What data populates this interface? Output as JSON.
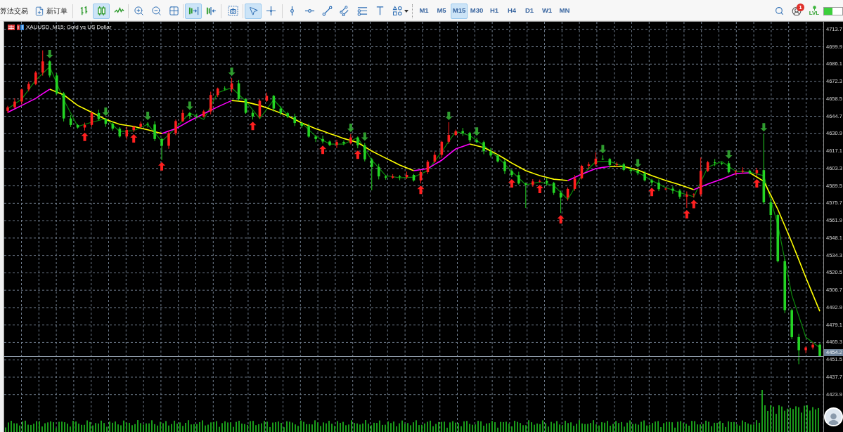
{
  "toolbar": {
    "algo_trading": "算法交易",
    "new_order": "新订单",
    "chart_types": [
      {
        "selected": false
      },
      {
        "selected": true
      },
      {
        "selected": false
      }
    ],
    "view_toggles": [
      {
        "selected": true
      },
      {
        "selected": false
      }
    ],
    "cursor_tools": [
      {
        "selected": true
      },
      {
        "selected": false
      }
    ],
    "timeframes": [
      {
        "label": "M1",
        "selected": false
      },
      {
        "label": "M5",
        "selected": false
      },
      {
        "label": "M15",
        "selected": true
      },
      {
        "label": "M30",
        "selected": false
      },
      {
        "label": "H1",
        "selected": false
      },
      {
        "label": "H4",
        "selected": false
      },
      {
        "label": "D1",
        "selected": false
      },
      {
        "label": "W1",
        "selected": false
      },
      {
        "label": "MN",
        "selected": false
      }
    ],
    "notification_badge": "1",
    "lvl_label": "LVL"
  },
  "chart": {
    "title": "XAUUSD, M15: Gold vs US Dollar",
    "current_price": "4454.2",
    "chart_data": {
      "type": "candlestick",
      "grid": true,
      "ylim": [
        4394.2,
        4719.7
      ],
      "yticks": [
        4713.7,
        4699.9,
        4686.1,
        4672.3,
        4658.5,
        4644.7,
        4630.9,
        4617.1,
        4603.3,
        4589.5,
        4575.7,
        4561.9,
        4548.1,
        4534.3,
        4520.5,
        4506.7,
        4492.9,
        4479.1,
        4465.3,
        4451.5,
        4437.7,
        4423.9
      ],
      "ohlc": [
        [
          4649.0,
          4653.0,
          4647.4,
          4651.8
        ],
        [
          4651.8,
          4659.0,
          4650.9,
          4656.4
        ],
        [
          4656.4,
          4666.8,
          4654.0,
          4666.0
        ],
        [
          4666.0,
          4672.1,
          4664.4,
          4670.3
        ],
        [
          4670.3,
          4680.6,
          4669.4,
          4679.4
        ],
        [
          4679.4,
          4697.0,
          4677.0,
          4688.3
        ],
        [
          4688.3,
          4689.1,
          4675.5,
          4677.1
        ],
        [
          4677.1,
          4678.9,
          4661.9,
          4662.8
        ],
        [
          4662.8,
          4664.0,
          4640.6,
          4643.0
        ],
        [
          4643.0,
          4645.6,
          4636.2,
          4637.8
        ],
        [
          4637.8,
          4638.6,
          4634.9,
          4635.8
        ],
        [
          4635.8,
          4639.7,
          4633.4,
          4637.9
        ],
        [
          4637.9,
          4648.5,
          4636.3,
          4647.3
        ],
        [
          4647.3,
          4649.9,
          4641.6,
          4642.5
        ],
        [
          4642.5,
          4643.3,
          4636.3,
          4638.7
        ],
        [
          4638.7,
          4640.5,
          4633.3,
          4634.9
        ],
        [
          4634.9,
          4636.1,
          4627.8,
          4628.7
        ],
        [
          4628.7,
          4636.4,
          4626.3,
          4633.8
        ],
        [
          4633.8,
          4637.1,
          4632.2,
          4636.3
        ],
        [
          4636.3,
          4640.6,
          4635.4,
          4638.8
        ],
        [
          4638.8,
          4640.0,
          4635.8,
          4638.2
        ],
        [
          4638.2,
          4640.8,
          4625.1,
          4626.7
        ],
        [
          4626.7,
          4627.5,
          4610.0,
          4621.3
        ],
        [
          4621.3,
          4633.1,
          4618.9,
          4631.3
        ],
        [
          4631.3,
          4642.1,
          4629.7,
          4640.9
        ],
        [
          4640.9,
          4649.9,
          4640.0,
          4647.3
        ],
        [
          4647.3,
          4648.1,
          4642.6,
          4645.0
        ],
        [
          4645.0,
          4646.8,
          4643.0,
          4644.6
        ],
        [
          4644.6,
          4649.8,
          4643.7,
          4648.6
        ],
        [
          4648.6,
          4664.2,
          4646.2,
          4661.6
        ],
        [
          4661.6,
          4667.5,
          4660.0,
          4666.7
        ],
        [
          4666.7,
          4668.5,
          4665.2,
          4666.1
        ],
        [
          4666.1,
          4675.0,
          4663.7,
          4670.9
        ],
        [
          4670.9,
          4673.5,
          4656.7,
          4658.3
        ],
        [
          4658.3,
          4659.1,
          4646.6,
          4647.5
        ],
        [
          4647.5,
          4649.3,
          4642.1,
          4644.5
        ],
        [
          4644.5,
          4658.2,
          4642.9,
          4657.0
        ],
        [
          4657.0,
          4663.5,
          4656.1,
          4660.9
        ],
        [
          4660.9,
          4661.7,
          4648.4,
          4650.8
        ],
        [
          4650.8,
          4652.6,
          4645.5,
          4647.1
        ],
        [
          4647.1,
          4648.3,
          4643.3,
          4644.2
        ],
        [
          4644.2,
          4646.8,
          4637.0,
          4639.4
        ],
        [
          4639.4,
          4640.2,
          4635.5,
          4637.1
        ],
        [
          4637.1,
          4638.9,
          4627.7,
          4628.6
        ],
        [
          4628.6,
          4629.8,
          4624.3,
          4626.7
        ],
        [
          4626.7,
          4629.3,
          4623.1,
          4624.7
        ],
        [
          4624.7,
          4625.5,
          4621.0,
          4621.9
        ],
        [
          4621.9,
          4626.1,
          4619.5,
          4624.3
        ],
        [
          4624.3,
          4625.5,
          4621.7,
          4623.3
        ],
        [
          4623.3,
          4630.5,
          4622.4,
          4627.9
        ],
        [
          4627.9,
          4628.7,
          4619.3,
          4621.7
        ],
        [
          4621.7,
          4623.5,
          4608.9,
          4610.5
        ],
        [
          4610.5,
          4611.7,
          4586.0,
          4604.5
        ],
        [
          4604.5,
          4607.1,
          4594.6,
          4597.0
        ],
        [
          4597.0,
          4597.8,
          4594.4,
          4596.0
        ],
        [
          4596.0,
          4598.8,
          4595.1,
          4597.0
        ],
        [
          4597.0,
          4598.2,
          4594.0,
          4596.4
        ],
        [
          4596.4,
          4600.8,
          4594.8,
          4598.2
        ],
        [
          4598.2,
          4599.0,
          4592.9,
          4593.8
        ],
        [
          4593.8,
          4602.2,
          4591.4,
          4600.4
        ],
        [
          4600.4,
          4609.9,
          4598.8,
          4608.7
        ],
        [
          4608.7,
          4616.7,
          4607.8,
          4614.1
        ],
        [
          4614.1,
          4625.3,
          4611.7,
          4624.5
        ],
        [
          4624.5,
          4640.0,
          4622.9,
          4629.9
        ],
        [
          4629.9,
          4634.1,
          4629.0,
          4632.9
        ],
        [
          4632.9,
          4635.5,
          4629.1,
          4631.5
        ],
        [
          4631.5,
          4632.3,
          4624.2,
          4625.8
        ],
        [
          4625.8,
          4627.6,
          4623.3,
          4624.2
        ],
        [
          4624.2,
          4625.4,
          4614.6,
          4617.0
        ],
        [
          4617.0,
          4619.6,
          4612.0,
          4613.6
        ],
        [
          4613.6,
          4614.4,
          4608.0,
          4608.9
        ],
        [
          4608.9,
          4610.7,
          4598.9,
          4601.3
        ],
        [
          4601.3,
          4602.5,
          4596.5,
          4598.1
        ],
        [
          4598.1,
          4600.7,
          4590.5,
          4591.4
        ],
        [
          4591.4,
          4592.2,
          4572.0,
          4590.4
        ],
        [
          4590.4,
          4594.8,
          4588.8,
          4593.0
        ],
        [
          4593.0,
          4594.5,
          4592.1,
          4593.3
        ],
        [
          4593.3,
          4595.9,
          4589.5,
          4591.9
        ],
        [
          4591.9,
          4592.7,
          4582.3,
          4583.9
        ],
        [
          4583.9,
          4585.7,
          4568.0,
          4580.2
        ],
        [
          4580.2,
          4588.3,
          4577.8,
          4587.1
        ],
        [
          4587.1,
          4598.1,
          4585.5,
          4595.5
        ],
        [
          4595.5,
          4606.2,
          4594.6,
          4605.4
        ],
        [
          4605.4,
          4608.3,
          4603.0,
          4606.5
        ],
        [
          4606.5,
          4616.0,
          4604.9,
          4611.1
        ],
        [
          4611.1,
          4613.7,
          4609.9,
          4610.8
        ],
        [
          4610.8,
          4611.6,
          4603.6,
          4606.0
        ],
        [
          4606.0,
          4608.4,
          4604.4,
          4606.6
        ],
        [
          4606.6,
          4607.8,
          4601.3,
          4602.2
        ],
        [
          4602.2,
          4604.8,
          4599.2,
          4601.6
        ],
        [
          4601.6,
          4602.4,
          4598.0,
          4599.6
        ],
        [
          4599.6,
          4601.4,
          4593.0,
          4593.9
        ],
        [
          4593.9,
          4595.1,
          4589.7,
          4592.1
        ],
        [
          4592.1,
          4594.7,
          4585.3,
          4586.9
        ],
        [
          4586.9,
          4588.1,
          4586.0,
          4587.3
        ],
        [
          4587.3,
          4589.1,
          4583.3,
          4585.7
        ],
        [
          4585.7,
          4586.9,
          4579.3,
          4580.9
        ],
        [
          4580.9,
          4585.1,
          4572.0,
          4582.5
        ],
        [
          4582.5,
          4583.6,
          4580.1,
          4582.8
        ],
        [
          4582.8,
          4612.0,
          4581.2,
          4601.4
        ],
        [
          4601.4,
          4609.4,
          4600.5,
          4608.2
        ],
        [
          4608.2,
          4610.8,
          4605.2,
          4607.6
        ],
        [
          4607.6,
          4608.4,
          4605.9,
          4607.5
        ],
        [
          4607.5,
          4609.3,
          4599.4,
          4600.3
        ],
        [
          4600.3,
          4602.0,
          4597.9,
          4600.8
        ],
        [
          4600.8,
          4604.2,
          4599.2,
          4601.6
        ],
        [
          4601.6,
          4602.4,
          4598.7,
          4599.6
        ],
        [
          4599.6,
          4603.8,
          4597.2,
          4602.0
        ],
        [
          4602.0,
          4631.0,
          4574.8,
          4576.4
        ],
        [
          4576.4,
          4579.0,
          4530.7,
          4566.4
        ],
        [
          4566.4,
          4567.2,
          4528.8,
          4529.7
        ],
        [
          4529.7,
          4531.5,
          4488.5,
          4490.9
        ],
        [
          4490.9,
          4492.1,
          4467.9,
          4469.5
        ],
        [
          4469.5,
          4472.1,
          4448.0,
          4459.1
        ],
        [
          4459.1,
          4462.1,
          4456.7,
          4461.3
        ],
        [
          4461.3,
          4465.3,
          4459.7,
          4463.5
        ],
        [
          4463.5,
          4464.7,
          4453.8,
          4454.2
        ]
      ],
      "series": [
        {
          "type": "line",
          "color": "#0c8a0c",
          "values": [
            4650.6,
            4654.5,
            4658.4,
            4665.9,
            4673.4,
            4678.7,
            4684.0,
            4670.9,
            4657.8,
            4647.2,
            4636.6,
            4638.3,
            4640.0,
            4641.4,
            4642.8,
            4637.8,
            4632.7,
            4633.0,
            4633.3,
            4635.8,
            4638.3,
            4631.6,
            4624.9,
            4630.2,
            4635.5,
            4641.4,
            4647.2,
            4644.7,
            4642.2,
            4652.8,
            4663.4,
            4665.4,
            4667.3,
            4662.0,
            4656.7,
            4649.8,
            4642.8,
            4650.3,
            4657.8,
            4651.7,
            4645.5,
            4642.5,
            4639.4,
            4634.1,
            4628.8,
            4625.8,
            4622.7,
            4622.7,
            4622.7,
            4625.2,
            4627.7,
            4618.8,
            4609.9,
            4603.8,
            4597.6,
            4596.8,
            4595.9,
            4596.2,
            4596.5,
            4599.0,
            4601.5,
            4609.1,
            4616.6,
            4624.7,
            4632.7,
            4631.1,
            4629.4,
            4625.5,
            4621.6,
            4616.9,
            4612.1,
            4606.6,
            4601.0,
            4595.7,
            4590.4,
            4591.5,
            4592.6,
            4591.2,
            4589.8,
            4584.3,
            4578.7,
            4588.2,
            4597.6,
            4603.2,
            4608.8,
            4608.8,
            4608.8,
            4606.9,
            4604.9,
            4602.7,
            4600.4,
            4597.1,
            4593.7,
            4590.9,
            4588.1,
            4586.2,
            4584.2,
            4582.6,
            4580.9,
            4592.6,
            4604.3,
            4606.6,
            4608.8,
            4604.9,
            4601.0,
            4600.7,
            4600.4,
            4599.0,
            4597.6,
            4578.1,
            4558.6,
            4530.8,
            4502.9,
            4486.2,
            4469.4,
            4465.3,
            4461.1
          ]
        },
        {
          "type": "line",
          "color": "#ffff00",
          "values": [
            null,
            null,
            null,
            null,
            null,
            null,
            4666.2,
            4664.0,
            4661.7,
            4657.5,
            4653.3,
            4650.6,
            4647.8,
            4645.0,
            4642.2,
            4640.3,
            4638.3,
            4637.5,
            4636.6,
            4635.3,
            4634.0,
            4632.5,
            4631.0,
            null,
            null,
            null,
            null,
            null,
            null,
            null,
            null,
            null,
            4657.2,
            4656.7,
            4656.1,
            4654.7,
            4653.3,
            4651.4,
            4649.4,
            4647.2,
            4645.0,
            4642.2,
            4639.4,
            4637.2,
            4634.9,
            4633.0,
            4631.0,
            4629.1,
            4627.1,
            4625.5,
            4623.8,
            4620.5,
            4617.1,
            4614.3,
            4611.5,
            4608.8,
            4606.0,
            4603.8,
            4601.5,
            null,
            null,
            null,
            null,
            null,
            null,
            null,
            4622.7,
            4621.3,
            4619.9,
            4617.1,
            4614.3,
            4611.0,
            4607.6,
            4604.6,
            4601.5,
            4599.6,
            4597.6,
            4596.2,
            4594.8,
            4594.3,
            4593.7,
            null,
            null,
            null,
            null,
            null,
            4604.9,
            4604.9,
            4604.9,
            4603.5,
            4602.1,
            4599.9,
            4597.6,
            4595.7,
            4593.7,
            4592.1,
            4590.4,
            4588.5,
            4586.5,
            null,
            null,
            null,
            null,
            null,
            null,
            null,
            4599.8,
            4596.5,
            4593.1,
            4582.0,
            4570.9,
            4557.8,
            4544.7,
            4530.8,
            4516.8,
            4503.4,
            4490.0
          ]
        },
        {
          "type": "line",
          "color": "#ff00ff",
          "values": [
            4647.8,
            4650.6,
            4653.3,
            4656.1,
            4658.9,
            4662.6,
            4666.2,
            null,
            null,
            null,
            null,
            null,
            null,
            null,
            null,
            null,
            null,
            null,
            null,
            null,
            null,
            null,
            4631.0,
            4633.0,
            4634.9,
            4638.0,
            4641.1,
            4643.9,
            4646.7,
            4649.5,
            4652.2,
            4654.7,
            4657.2,
            null,
            null,
            null,
            null,
            null,
            null,
            null,
            null,
            null,
            null,
            null,
            null,
            null,
            null,
            null,
            null,
            null,
            null,
            null,
            null,
            null,
            null,
            null,
            null,
            null,
            4601.5,
            4602.4,
            4603.2,
            4606.6,
            4609.9,
            4614.4,
            4618.8,
            4620.8,
            4622.7,
            null,
            null,
            null,
            null,
            null,
            null,
            null,
            null,
            null,
            null,
            null,
            null,
            null,
            4593.7,
            4596.2,
            4598.7,
            4601.0,
            4603.2,
            4604.1,
            4604.9,
            null,
            null,
            null,
            null,
            null,
            null,
            null,
            null,
            null,
            null,
            null,
            4586.5,
            4588.7,
            4590.9,
            4592.9,
            4594.8,
            4597.1,
            4599.3,
            4599.6,
            4599.8,
            null,
            null,
            null,
            null,
            null,
            null,
            null,
            null,
            null,
            null
          ]
        }
      ]
    }
  }
}
